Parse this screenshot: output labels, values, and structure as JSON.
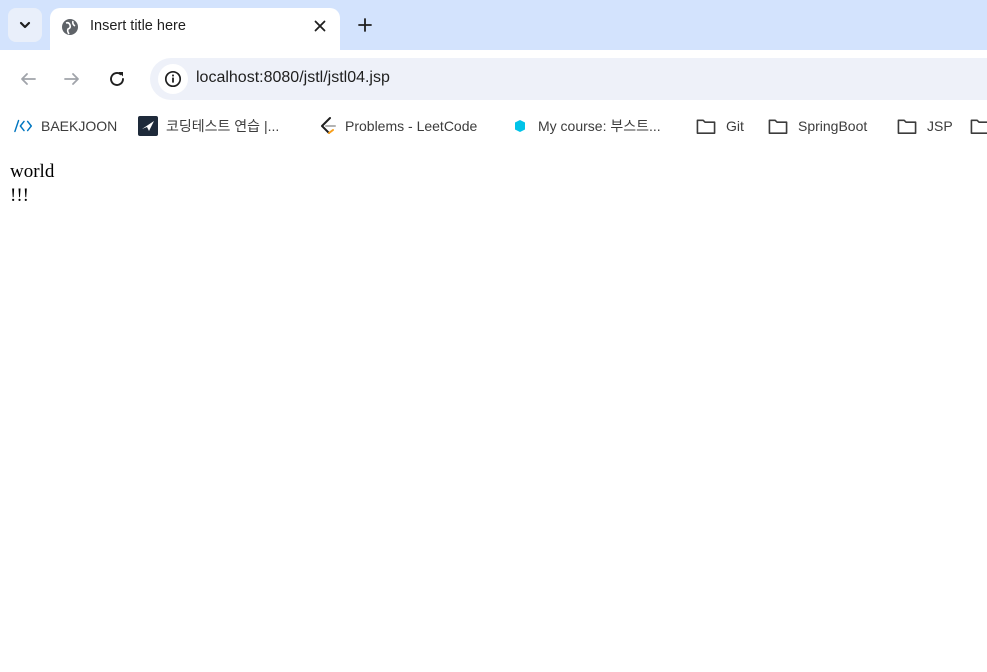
{
  "tab": {
    "title": "Insert title here"
  },
  "address_bar": {
    "url": "localhost:8080/jstl/jstl04.jsp"
  },
  "bookmarks": [
    {
      "label": "BAEKJOON",
      "icon": "code-icon"
    },
    {
      "label": "코딩테스트 연습 |...",
      "icon": "programmers-icon"
    },
    {
      "label": "Problems - LeetCode",
      "icon": "leetcode-icon"
    },
    {
      "label": "My course: 부스트...",
      "icon": "boostcourse-icon"
    },
    {
      "label": "Git",
      "icon": "folder-icon"
    },
    {
      "label": "SpringBoot",
      "icon": "folder-icon"
    },
    {
      "label": "JSP",
      "icon": "folder-icon"
    }
  ],
  "page": {
    "line1": "world",
    "line2": "!!!"
  },
  "colors": {
    "tabstrip": "#d3e3fd",
    "omnibox": "#eef1f9",
    "accent": "#0b57d0"
  }
}
